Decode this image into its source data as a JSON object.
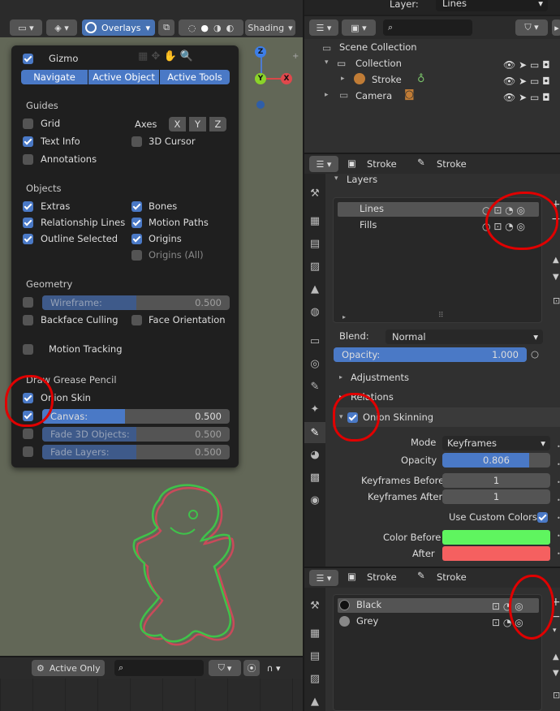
{
  "top_bar": {
    "layer_label": "Layer:",
    "layer_value": "Lines"
  },
  "viewport_header": {
    "overlays": "Overlays",
    "shading": "Shading"
  },
  "gizmo_axes": {
    "z": "Z",
    "y": "Y",
    "x": "X"
  },
  "overlay_panel": {
    "gizmo": {
      "label": "Gizmo",
      "tabs": [
        "Navigate",
        "Active Object",
        "Active Tools"
      ]
    },
    "guides": {
      "title": "Guides",
      "grid": "Grid",
      "text_info": "Text Info",
      "annotations": "Annotations",
      "axes": "Axes",
      "axis_buttons": [
        "X",
        "Y",
        "Z"
      ],
      "cursor": "3D Cursor"
    },
    "objects": {
      "title": "Objects",
      "extras": "Extras",
      "relationship_lines": "Relationship Lines",
      "outline_selected": "Outline Selected",
      "bones": "Bones",
      "motion_paths": "Motion Paths",
      "origins": "Origins",
      "origins_all": "Origins (All)"
    },
    "geometry": {
      "title": "Geometry",
      "wireframe_label": "Wireframe:",
      "wireframe_value": "0.500",
      "backface_culling": "Backface Culling",
      "face_orientation": "Face Orientation"
    },
    "motion_tracking": "Motion Tracking",
    "grease_pencil": {
      "title": "Draw Grease Pencil",
      "onion_skin": "Onion Skin",
      "canvas_label": "Canvas:",
      "canvas_value": "0.500",
      "canvas_fill": 0.5,
      "fade_3d_label": "Fade 3D Objects:",
      "fade_3d_value": "0.500",
      "fade_layers_label": "Fade Layers:",
      "fade_layers_value": "0.500"
    }
  },
  "timeline_header": {
    "active_only": "Active Only"
  },
  "outliner": {
    "rows": [
      {
        "label": "Scene Collection"
      },
      {
        "label": "Collection"
      },
      {
        "label": "Stroke"
      },
      {
        "label": "Camera"
      }
    ]
  },
  "properties_top": {
    "breadcrumb_object": "Stroke",
    "breadcrumb_data": "Stroke",
    "layers_panel": "Layers",
    "layers": [
      "Lines",
      "Fills"
    ],
    "blend_label": "Blend:",
    "blend_value": "Normal",
    "opacity_label": "Opacity:",
    "opacity_value": "1.000",
    "opacity_fill": 1.0,
    "adjustments": "Adjustments",
    "relations": "Relations",
    "onion_skinning": "Onion Skinning",
    "mode_label": "Mode",
    "mode_value": "Keyframes",
    "onion_opacity_label": "Opacity",
    "onion_opacity_value": "0.806",
    "onion_opacity_fill": 0.806,
    "keyframes_before_label": "Keyframes Before",
    "keyframes_before_value": "1",
    "keyframes_after_label": "Keyframes After",
    "keyframes_after_value": "1",
    "use_custom_colors": "Use Custom Colors",
    "color_before_label": "Color Before",
    "color_before": "#5ff55f",
    "color_after_label": "After",
    "color_after": "#f56060"
  },
  "properties_bottom": {
    "breadcrumb_object": "Stroke",
    "breadcrumb_data": "Stroke",
    "materials": [
      "Black",
      "Grey"
    ]
  }
}
